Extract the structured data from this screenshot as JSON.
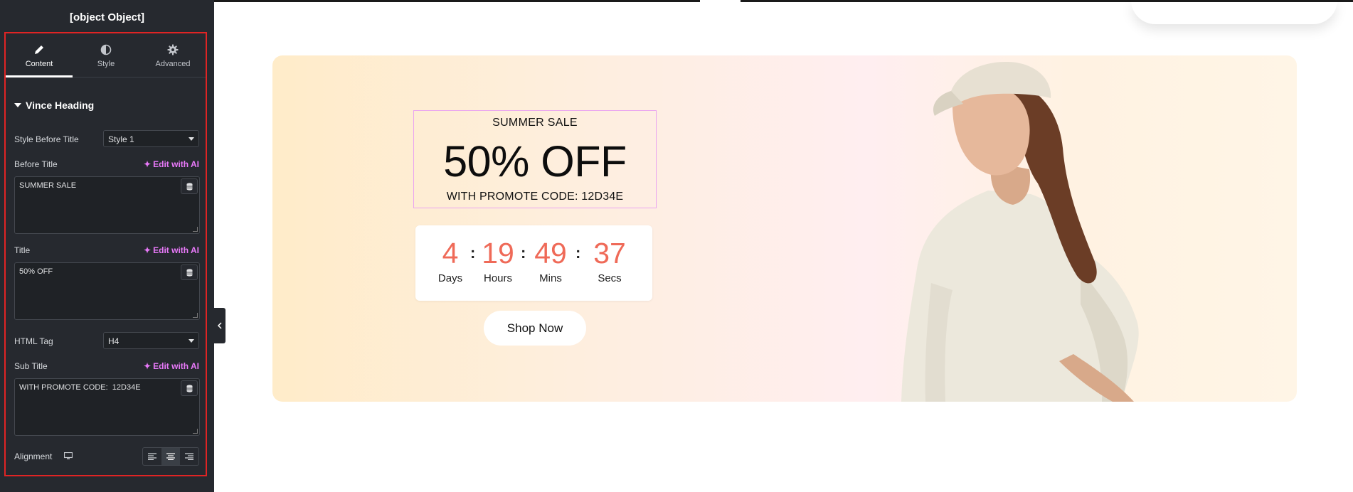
{
  "panel": {
    "title": {
      "label": "Title",
      "ai": "Edit with AI",
      "value": "50% OFF"
    },
    "tabs": [
      {
        "label": "Content",
        "icon": "pencil-icon",
        "active": true
      },
      {
        "label": "Style",
        "icon": "contrast-icon",
        "active": false
      },
      {
        "label": "Advanced",
        "icon": "gear-icon",
        "active": false
      }
    ],
    "section": "Vince Heading",
    "style_before_title": {
      "label": "Style Before Title",
      "value": "Style 1"
    },
    "before_title": {
      "label": "Before Title",
      "ai": "Edit with AI",
      "value": "SUMMER SALE"
    },
    "html_tag": {
      "label": "HTML Tag",
      "value": "H4"
    },
    "sub_title": {
      "label": "Sub Title",
      "ai": "Edit with AI",
      "value": "WITH PROMOTE CODE:  12D34E"
    },
    "alignment": {
      "label": "Alignment",
      "device_icon": "desktop-icon",
      "selected": "center"
    }
  },
  "banner": {
    "before_title": "SUMMER SALE",
    "title": "50% OFF",
    "sub_title": "WITH PROMOTE CODE: 12D34E",
    "countdown": [
      {
        "value": "4",
        "label": "Days"
      },
      {
        "value": "19",
        "label": "Hours"
      },
      {
        "value": "49",
        "label": "Mins"
      },
      {
        "value": "37",
        "label": "Secs"
      }
    ],
    "separator": ":",
    "button": "Shop Now"
  },
  "colors": {
    "panel_bg": "#26292f",
    "accent_ai": "#e879f9",
    "selection_outline": "#e02424",
    "countdown_number": "#ef6a58"
  }
}
